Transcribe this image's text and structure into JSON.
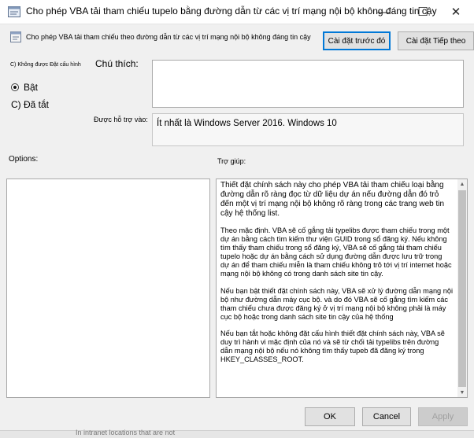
{
  "window": {
    "title": "Cho phép VBA tải tham chiếu tupelo bằng đường dẫn từ các vị trí mạng nội bộ không đáng tin cậy",
    "minimize": "—",
    "maximize": "☐",
    "close": "✕"
  },
  "toolbar": {
    "setting_name": "Cho phép VBA tải tham chiếu theo đường dẫn từ các vị trí mạng nội bộ không đáng tin cậy",
    "prev_button": "Cài đặt trước đó",
    "next_button": "Cài đặt Tiếp theo"
  },
  "state": {
    "not_configured": "C) Không được Đặt cấu hình",
    "enabled": "Bật",
    "disabled": "C) Đã tắt",
    "selected": "enabled"
  },
  "comment": {
    "label": "Chú thích:",
    "value": ""
  },
  "supported": {
    "label": "Được hỗ trợ vào:",
    "value": "Ít nhất là Windows Server 2016. Windows 10"
  },
  "options": {
    "label": "Options:"
  },
  "help": {
    "label": "Trợ giúp:",
    "paragraphs": [
      "Thiết đặt chính sách này cho phép VBA tải tham chiếu loại bằng đường dẫn rõ ràng đọc từ dữ liệu dự án nếu đường dẫn đó trỏ đến một vị trí mạng nội bộ không rõ ràng trong các trang web tin cậy hệ thống list.",
      "Theo mặc định. VBA sẽ cố gắng tải typelibs được tham chiếu trong một dự án bằng cách tìm kiếm thư viện GUID trong sổ đăng ký. Nếu không tìm thấy tham chiếu trong sổ đăng ký, VBA sẽ cố gắng tải tham chiếu tupelo hoặc dự án bằng cách sử dụng đường dẫn được lưu trữ trong dự án để tham chiếu miễn là tham chiếu không trỏ tới vị trí internet hoặc mạng nội bộ không có trong danh sách site tin cậy.",
      "Nếu bạn bật thiết đặt chính sách này, VBA sẽ xử lý đường dẫn mạng nội bộ như đường dẫn máy cục bộ. và do đó VBA sẽ cố gắng tìm kiếm các tham chiếu chưa được đăng ký ở vị trí mạng nội bộ không phải là máy cục bộ hoặc trong danh sách site tin cậy của hệ thống",
      "Nếu bạn tắt hoặc không đặt cấu hình thiết đặt chính sách này, VBA sẽ duy trì hành vi mặc định của nó và sẽ từ chối tải typelibs trên đường dẫn mạng nội bộ nếu nó không tìm thấy tupeb đã đăng ký trong HKEY_CLASSES_ROOT."
    ]
  },
  "footer": {
    "ok": "OK",
    "cancel": "Cancel",
    "apply": "Apply",
    "background_text": "In intranet locations that are not"
  },
  "colors": {
    "focus": "#0078d7",
    "background": "#f0f0f0",
    "disabled_text": "#a0a0a0"
  }
}
